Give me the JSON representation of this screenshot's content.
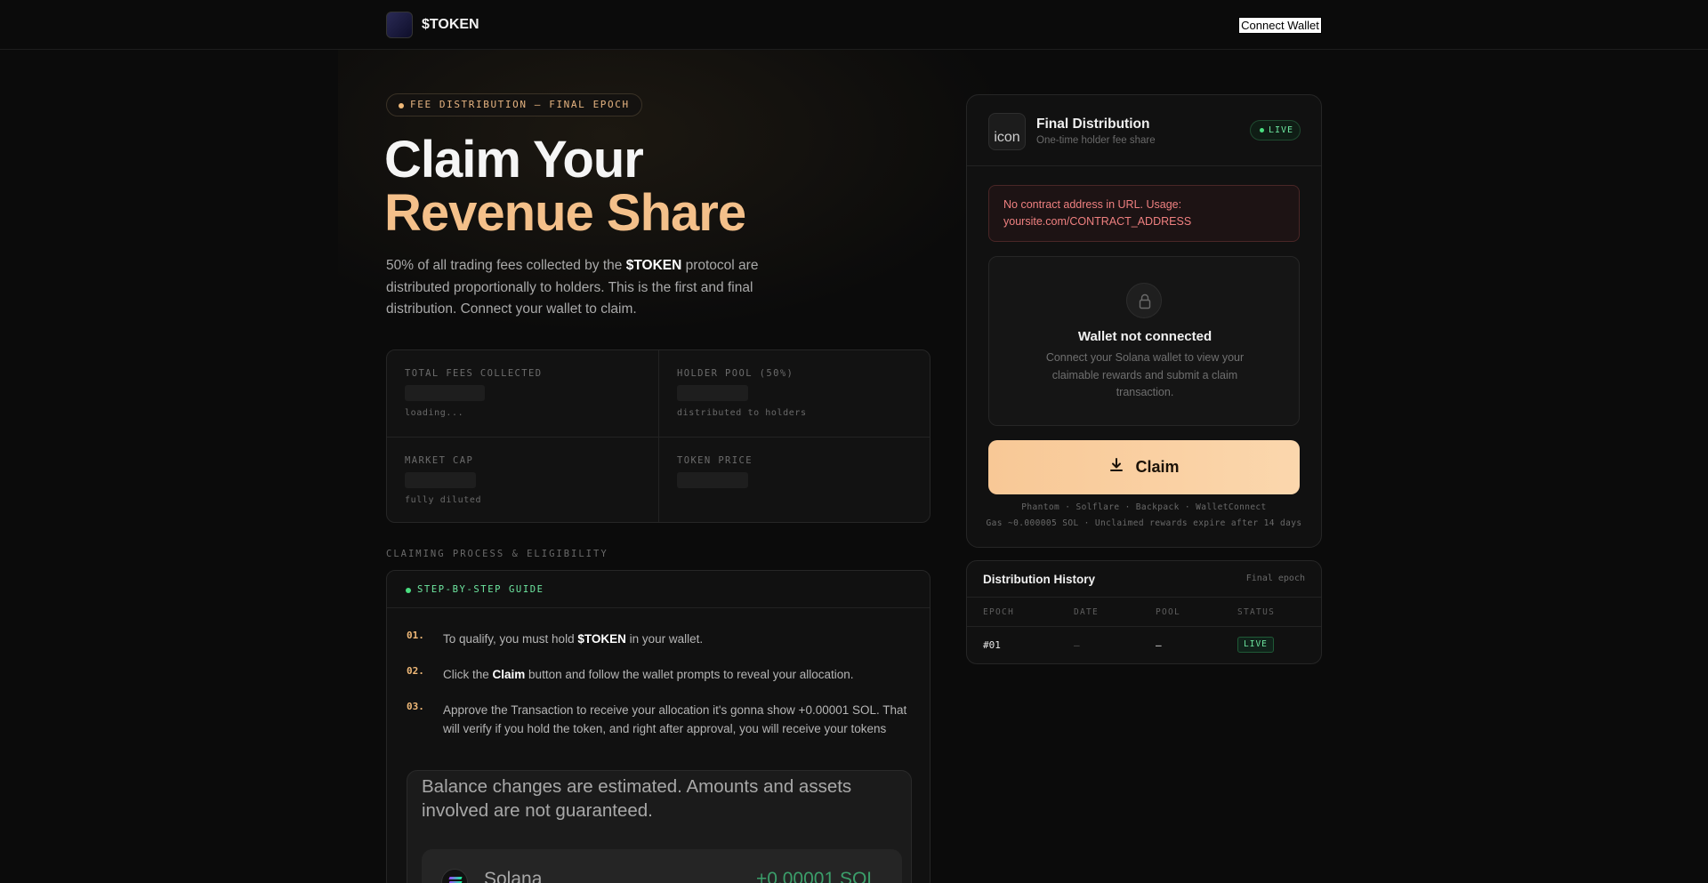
{
  "header": {
    "brand": "$TOKEN",
    "connect_label": "Connect Wallet"
  },
  "hero": {
    "pill": "FEE DISTRIBUTION — FINAL EPOCH",
    "title_line1": "Claim Your",
    "title_line2": "Revenue Share",
    "desc_pre": "50% of all trading fees collected by the ",
    "desc_token": "$TOKEN",
    "desc_post": " protocol are distributed proportionally to holders. This is the first and final distribution. Connect your wallet to claim."
  },
  "stats": [
    {
      "label": "TOTAL FEES COLLECTED",
      "sub": "loading..."
    },
    {
      "label": "HOLDER POOL (50%)",
      "sub": "distributed to holders"
    },
    {
      "label": "MARKET CAP",
      "sub": "fully diluted"
    },
    {
      "label": "TOKEN PRICE",
      "sub": ""
    }
  ],
  "guide": {
    "section_title": "CLAIMING PROCESS & ELIGIBILITY",
    "header": "STEP-BY-STEP GUIDE",
    "steps": [
      {
        "num": "01.",
        "pre": "To qualify, you must hold ",
        "bold": "$TOKEN",
        "post": " in your wallet."
      },
      {
        "num": "02.",
        "pre": "Click the ",
        "bold": "Claim",
        "post": " button and follow the wallet prompts to reveal your allocation."
      },
      {
        "num": "03.",
        "pre": "Approve the Transaction to receive your allocation it's gonna show +0.00001 SOL. That will verify if you hold the token, and right after approval, you will receive your tokens",
        "bold": "",
        "post": ""
      }
    ],
    "screenshot": {
      "note": "Balance changes are estimated. Amounts and assets involved are not guaranteed.",
      "asset": "Solana",
      "amount": "+0.00001 SOL"
    }
  },
  "card": {
    "icon_alt": "icon",
    "title": "Final Distribution",
    "subtitle": "One-time holder fee share",
    "live": "LIVE",
    "error_text": "No contract address in URL. Usage: yoursite.com/CONTRACT_ADDRESS",
    "not_connected_title": "Wallet not connected",
    "not_connected_text": "Connect your Solana wallet to view your claimable rewards and submit a claim transaction.",
    "claim_label": "Claim",
    "wallets": "Phantom · Solflare · Backpack · WalletConnect",
    "gas": "Gas ~0.000005 SOL · Unclaimed rewards expire after 14 days"
  },
  "history": {
    "title": "Distribution History",
    "tag": "Final epoch",
    "columns": [
      "EPOCH",
      "DATE",
      "POOL",
      "STATUS"
    ],
    "rows": [
      {
        "epoch": "#01",
        "date": "—",
        "pool": "—",
        "status": "LIVE"
      }
    ]
  },
  "colors": {
    "accent": "#f4c08a",
    "live_green": "#4ade80",
    "error_red": "#ef8080"
  }
}
